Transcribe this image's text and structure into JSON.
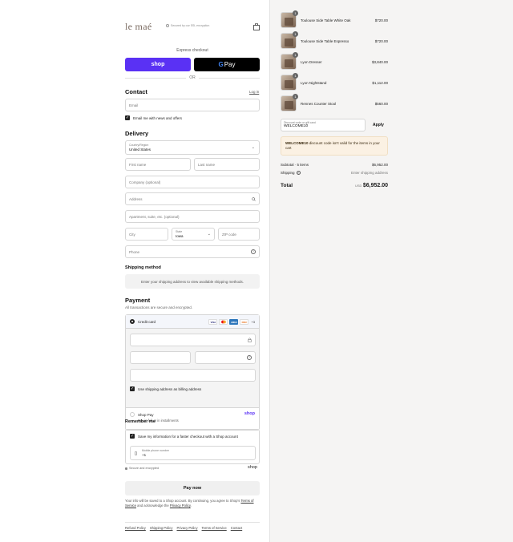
{
  "brand": {
    "logo": "le maé",
    "secure_note": "Secured by our SSL encryption"
  },
  "express": {
    "label": "Express checkout",
    "shop_label": "shop",
    "gpay_label": "Pay",
    "gpay_g": "G",
    "or_label": "OR"
  },
  "contact": {
    "heading": "Contact",
    "login_label": "Log in",
    "email_placeholder": "Email",
    "newsletter_label": "Email me with news and offers"
  },
  "delivery": {
    "heading": "Delivery",
    "country_label": "Country/Region",
    "country_value": "United States",
    "first_name": "First name",
    "last_name": "Last name",
    "company": "Company (optional)",
    "address": "Address",
    "apartment": "Apartment, suite, etc. (optional)",
    "city": "City",
    "state_label": "State",
    "state_value": "Iowa",
    "zip": "ZIP code",
    "phone": "Phone"
  },
  "shipping_method": {
    "heading": "Shipping method",
    "note": "Enter your shipping address to view available shipping methods."
  },
  "payment": {
    "heading": "Payment",
    "subtitle": "All transactions are secure and encrypted.",
    "credit_card_label": "Credit card",
    "cards": [
      "VISA",
      "MC",
      "AMEX",
      "DISC"
    ],
    "more_cards": "+3",
    "billing_label": "Use shipping address as billing address",
    "shop_pay_label": "Shop Pay",
    "shop_pay_sub": "Pay in full or in installments",
    "shop_pay_logo": "shop"
  },
  "remember": {
    "heading": "Remember me",
    "save_label": "Save my information for a faster checkout with a Shop account",
    "mobile_label": "Mobile phone number",
    "mobile_value": "+1",
    "secure_label": "Secure and encrypted",
    "shop_logo": "shop"
  },
  "paynow_label": "Pay now",
  "terms": {
    "text1": "Your info will be saved to a Shop account. By continuing, you agree to Shop's",
    "tos": "Terms of Service",
    "text2": "and acknowledge the",
    "privacy": "Privacy Policy",
    "end": "."
  },
  "footer": [
    "Refund Policy",
    "Shipping Policy",
    "Privacy Policy",
    "Terms of Service",
    "Contact"
  ],
  "cart": {
    "items": [
      {
        "name": "Toulouse Side Table White Oak",
        "price": "$720.00",
        "qty": "1"
      },
      {
        "name": "Toulouse Side Table Espresso",
        "price": "$720.00",
        "qty": "1"
      },
      {
        "name": "Lyon Dresser",
        "price": "$3,840.00",
        "qty": "1"
      },
      {
        "name": "Lyon Nightstand",
        "price": "$1,112.00",
        "qty": "1"
      },
      {
        "name": "Rennes Counter Stool",
        "price": "$560.00",
        "qty": "1"
      }
    ],
    "discount_label": "Discount code or gift card",
    "discount_value": "WELCOME10",
    "apply_label": "Apply",
    "warning_code": "WELCOME10",
    "warning_text": " discount code isn't valid for the items in your cart",
    "subtotal_label": "Subtotal · 5 items",
    "subtotal_value": "$6,952.00",
    "shipping_label": "Shipping",
    "shipping_value": "Enter shipping address",
    "total_label": "Total",
    "currency": "USD",
    "total_value": "$6,952.00"
  }
}
